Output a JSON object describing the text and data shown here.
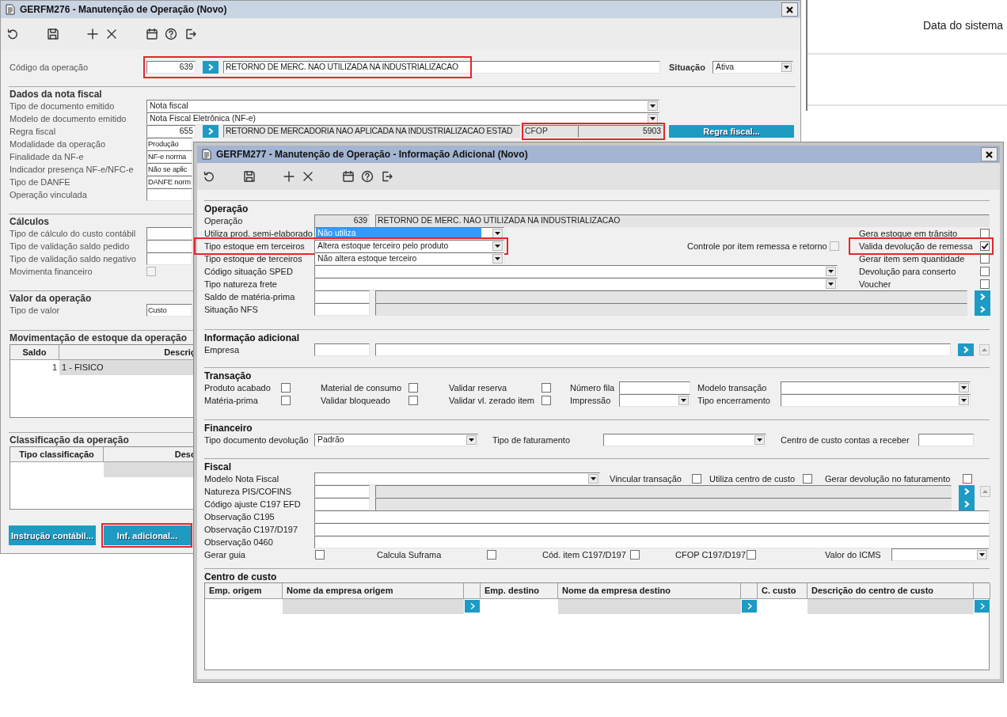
{
  "main_window": {
    "title": "GERFM276 - Manutenção de Operação (Novo)",
    "header": {
      "items": [
        {
          "kind": "lookup",
          "label": "Código da operação",
          "code": "639",
          "description": "RETORNO DE MERC. NAO UTILIZADA NA INDUSTRIALIZACAO",
          "readonly": false,
          "highlighted": true
        },
        {
          "kind": "select",
          "label": "Situação",
          "value": "Ativa",
          "focused": false,
          "highlighted": false
        }
      ]
    },
    "sections": [
      {
        "title": "Dados da nota fiscal",
        "rows": [
          {
            "items": [
              {
                "kind": "select",
                "label": "Tipo de documento emitido",
                "value": "Nota fiscal",
                "focused": false,
                "highlighted": false
              }
            ]
          },
          {
            "items": [
              {
                "kind": "select",
                "label": "Modelo de documento emitido",
                "value": "Nota Fiscal Eletrônica (NF-e)",
                "focused": false,
                "highlighted": false
              }
            ]
          },
          {
            "items": [
              {
                "kind": "lookup",
                "label": "Regra fiscal",
                "code": "655",
                "description": "RETORNO DE MERCADORIA NAO APLICADA NA INDUSTRIALIZACAO ESTAD",
                "readonly": true,
                "highlighted": false
              },
              {
                "kind": "cfop",
                "label": "CFOP",
                "value": "5903",
                "highlighted": true
              },
              {
                "kind": "button",
                "label": "Regra fiscal...",
                "highlighted": false
              }
            ]
          },
          {
            "items": [
              {
                "kind": "text",
                "label": "Modalidade da operação",
                "value": "Produção",
                "highlighted": false
              }
            ]
          },
          {
            "items": [
              {
                "kind": "text",
                "label": "Finalidade da NF-e",
                "value": "NF-e norma",
                "highlighted": false
              }
            ]
          },
          {
            "items": [
              {
                "kind": "text",
                "label": "Indicador presença NF-e/NFC-e",
                "value": "Não se aplic",
                "highlighted": false
              }
            ]
          },
          {
            "items": [
              {
                "kind": "text",
                "label": "Tipo de DANFE",
                "value": "DANFE norm",
                "highlighted": false
              }
            ]
          },
          {
            "items": [
              {
                "kind": "text",
                "label": "Operação vinculada",
                "highlighted": false
              }
            ]
          }
        ]
      },
      {
        "title": "Cálculos",
        "rows": [
          {
            "items": [
              {
                "kind": "text",
                "label": "Tipo de cálculo do custo contábil",
                "highlighted": false
              }
            ]
          },
          {
            "items": [
              {
                "kind": "text",
                "label": "Tipo de validação saldo pedido",
                "highlighted": false
              }
            ]
          },
          {
            "items": [
              {
                "kind": "text",
                "label": "Tipo de validação saldo negativo",
                "highlighted": false
              }
            ]
          },
          {
            "items": [
              {
                "kind": "check",
                "label": "Movimenta financeiro",
                "checked": false,
                "disabled": true,
                "highlighted": false
              }
            ]
          }
        ]
      },
      {
        "title": "Valor da operação",
        "rows": [
          {
            "items": [
              {
                "kind": "text",
                "label": "Tipo de valor",
                "value": "Custo",
                "highlighted": false
              }
            ]
          }
        ]
      },
      {
        "title": "Movimentação de estoque da operação",
        "table": {
          "columns": [
            {
              "label": "Saldo"
            },
            {
              "label": "Descriç"
            }
          ],
          "rows": [
            {
              "cells": [
                "1",
                "1 - FISICO"
              ]
            }
          ]
        }
      },
      {
        "title": "Classificação da operação",
        "table": {
          "columns": [
            {
              "label": "Tipo classificação"
            },
            {
              "label": "Desc"
            }
          ]
        }
      }
    ],
    "buttons": [
      {
        "label": "Instrução contábil...",
        "highlighted": false
      },
      {
        "label": "Inf. adicional...",
        "highlighted": true
      }
    ]
  },
  "system_panel": {
    "label": "Data do sistema"
  },
  "info_window": {
    "title": "GERFM277 - Manutenção de Operação - Informação Adicional (Novo)",
    "sections": [
      {
        "title": "Operação",
        "rows": [
          {
            "items": [
              {
                "kind": "display",
                "label": "Operação",
                "code": "639",
                "description": "RETORNO DE MERC. NAO UTILIZADA NA INDUSTRIALIZACAO",
                "highlighted": false
              }
            ]
          },
          {
            "items": [
              {
                "kind": "select",
                "label": "Utiliza prod. semi-elaborado",
                "value": "Não utiliza",
                "focused": true,
                "highlighted": false
              },
              {
                "kind": "check",
                "label": "Gera estoque em trânsito",
                "checked": false,
                "disabled": false,
                "highlighted": false
              }
            ]
          },
          {
            "items": [
              {
                "kind": "select",
                "label": "Tipo estoque em terceiros",
                "value": "Altera estoque terceiro pelo produto",
                "focused": false,
                "highlighted": true
              },
              {
                "kind": "check",
                "label": "Controle por item remessa e retorno",
                "checked": false,
                "disabled": true,
                "highlighted": false
              },
              {
                "kind": "check",
                "label": "Valida devolução de remessa",
                "checked": true,
                "disabled": false,
                "highlighted": true
              }
            ]
          },
          {
            "items": [
              {
                "kind": "select",
                "label": "Tipo estoque de terceiros",
                "value": "Não altera estoque terceiro",
                "focused": false,
                "highlighted": false
              },
              {
                "kind": "check",
                "label": "Gerar item sem quantidade",
                "checked": false,
                "disabled": false,
                "highlighted": false
              }
            ]
          },
          {
            "items": [
              {
                "kind": "select",
                "label": "Código situação SPED",
                "focused": false,
                "highlighted": false
              },
              {
                "kind": "check",
                "label": "Devolução para conserto",
                "checked": false,
                "disabled": false,
                "highlighted": false
              }
            ]
          },
          {
            "items": [
              {
                "kind": "select",
                "label": "Tipo natureza frete",
                "focused": false,
                "highlighted": false
              },
              {
                "kind": "check",
                "label": "Voucher",
                "checked": false,
                "disabled": false,
                "highlighted": false
              }
            ]
          },
          {
            "items": [
              {
                "kind": "lookup",
                "label": "Saldo de matéria-prima",
                "readonly": true,
                "highlighted": false
              }
            ]
          },
          {
            "items": [
              {
                "kind": "lookup",
                "label": "Situação NFS",
                "readonly": true,
                "highlighted": false
              }
            ]
          }
        ]
      },
      {
        "title": "Informação adicional",
        "rows": [
          {
            "items": [
              {
                "kind": "lookup",
                "label": "Empresa",
                "readonly": false,
                "highlighted": false
              }
            ]
          }
        ]
      },
      {
        "title": "Transação",
        "rows": [
          {
            "items": [
              {
                "kind": "check",
                "label": "Produto acabado",
                "checked": false,
                "disabled": false,
                "highlighted": false
              },
              {
                "kind": "check",
                "label": "Material de consumo",
                "checked": false,
                "disabled": false,
                "highlighted": false
              },
              {
                "kind": "check",
                "label": "Validar reserva",
                "checked": false,
                "disabled": false,
                "highlighted": false
              },
              {
                "kind": "text",
                "label": "Número fila",
                "highlighted": false
              },
              {
                "kind": "select",
                "label": "Modelo transação",
                "focused": false,
                "highlighted": false
              }
            ]
          },
          {
            "items": [
              {
                "kind": "check",
                "label": "Matéria-prima",
                "checked": false,
                "disabled": false,
                "highlighted": false
              },
              {
                "kind": "check",
                "label": "Validar bloqueado",
                "checked": false,
                "disabled": false,
                "highlighted": false
              },
              {
                "kind": "check",
                "label": "Validar vl. zerado item",
                "checked": false,
                "disabled": false,
                "highlighted": false
              },
              {
                "kind": "select",
                "label": "Impressão",
                "focused": false,
                "highlighted": false
              },
              {
                "kind": "select",
                "label": "Tipo encerramento",
                "focused": false,
                "highlighted": false
              }
            ]
          }
        ]
      },
      {
        "title": "Financeiro",
        "rows": [
          {
            "items": [
              {
                "kind": "select",
                "label": "Tipo documento devolução",
                "value": "Padrão",
                "focused": false,
                "highlighted": false
              },
              {
                "kind": "select",
                "label": "Tipo de faturamento",
                "focused": false,
                "highlighted": false
              },
              {
                "kind": "text",
                "label": "Centro de custo contas a receber",
                "highlighted": false
              }
            ]
          }
        ]
      },
      {
        "title": "Fiscal",
        "rows": [
          {
            "items": [
              {
                "kind": "select",
                "label": "Modelo Nota Fiscal",
                "focused": false,
                "highlighted": false
              },
              {
                "kind": "check",
                "label": "Vincular transação",
                "checked": false,
                "disabled": false,
                "highlighted": false
              },
              {
                "kind": "check",
                "label": "Utiliza centro de custo",
                "checked": false,
                "disabled": false,
                "highlighted": false
              },
              {
                "kind": "check",
                "label": "Gerar devolução no faturamento",
                "checked": false,
                "disabled": false,
                "highlighted": false
              }
            ]
          },
          {
            "items": [
              {
                "kind": "lookup",
                "label": "Natureza PIS/COFINS",
                "readonly": true,
                "highlighted": false
              }
            ]
          },
          {
            "items": [
              {
                "kind": "lookup",
                "label": "Código ajuste C197 EFD",
                "readonly": true,
                "highlighted": false
              }
            ]
          },
          {
            "items": [
              {
                "kind": "text",
                "label": "Observação C195",
                "highlighted": false
              }
            ]
          },
          {
            "items": [
              {
                "kind": "text",
                "label": "Observação C197/D197",
                "highlighted": false
              }
            ]
          },
          {
            "items": [
              {
                "kind": "text",
                "label": "Observação 0460",
                "highlighted": false
              }
            ]
          },
          {
            "items": [
              {
                "kind": "check",
                "label": "Gerar guia",
                "checked": false,
                "disabled": false,
                "highlighted": false
              },
              {
                "kind": "check",
                "label": "Calcula Suframa",
                "checked": false,
                "disabled": false,
                "highlighted": false
              },
              {
                "kind": "check",
                "label": "Cód. item C197/D197",
                "checked": false,
                "disabled": false,
                "highlighted": false
              },
              {
                "kind": "check",
                "label": "CFOP C197/D197",
                "checked": false,
                "disabled": false,
                "highlighted": false
              },
              {
                "kind": "select",
                "label": "Valor do ICMS",
                "focused": false,
                "highlighted": false
              }
            ]
          }
        ]
      },
      {
        "title": "Centro de custo",
        "table": {
          "columns": [
            {
              "kind": "code",
              "label": "Emp. origem"
            },
            {
              "kind": "name",
              "label": "Nome da empresa origem"
            },
            {
              "kind": "button"
            },
            {
              "kind": "code",
              "label": "Emp. destino"
            },
            {
              "kind": "name",
              "label": "Nome da empresa destino"
            },
            {
              "kind": "button"
            },
            {
              "kind": "code",
              "label": "C. custo"
            },
            {
              "kind": "name",
              "label": "Descrição do centro de custo"
            },
            {
              "kind": "button"
            }
          ]
        }
      }
    ]
  }
}
